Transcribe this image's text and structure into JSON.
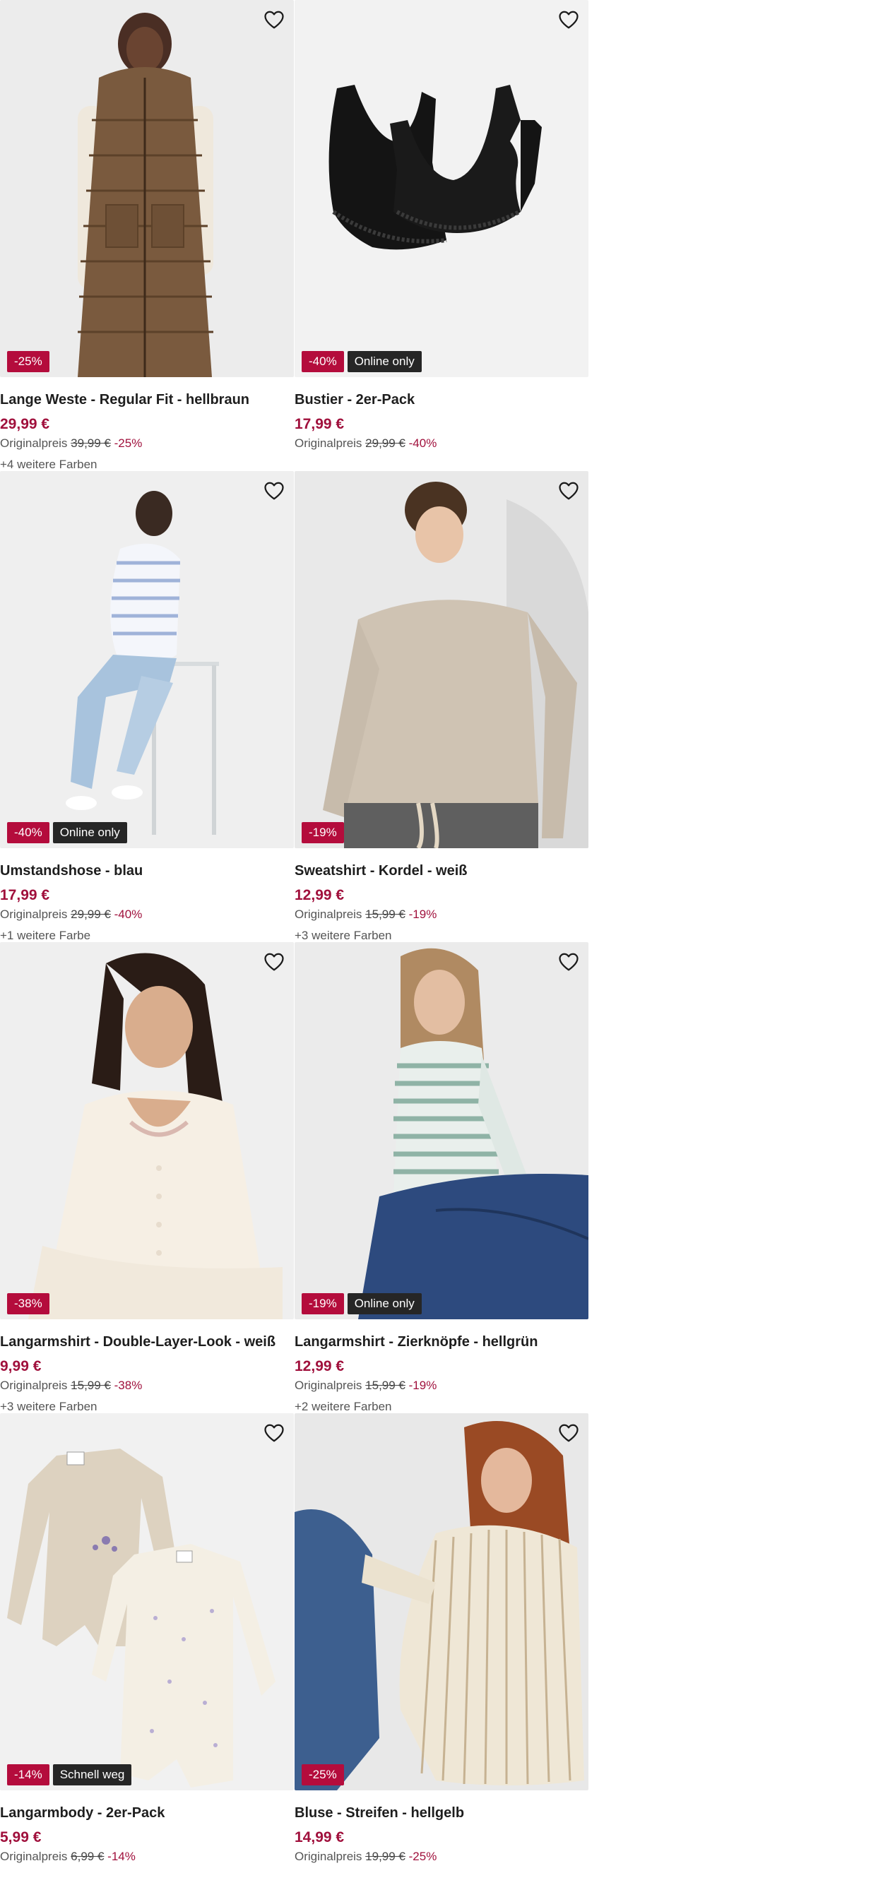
{
  "colors": {
    "discount_badge": "#b40c3c",
    "extra_badge": "#262626",
    "price": "#a0103c"
  },
  "products": [
    {
      "title": "Lange Weste - Regular Fit - hellbraun",
      "price": "29,99 €",
      "orig_label": "Originalpreis",
      "orig_price": "39,99 €",
      "pct": "-25%",
      "discount_badge": "-25%",
      "extra_badge": "",
      "colors_text": "+4 weitere Farben",
      "image": "puffer-vest"
    },
    {
      "title": "Bustier - 2er-Pack",
      "price": "17,99 €",
      "orig_label": "Originalpreis",
      "orig_price": "29,99 €",
      "pct": "-40%",
      "discount_badge": "-40%",
      "extra_badge": "Online only",
      "colors_text": "",
      "image": "black-bustiers"
    },
    {
      "title": "Umstandshose - blau",
      "price": "17,99 €",
      "orig_label": "Originalpreis",
      "orig_price": "29,99 €",
      "pct": "-40%",
      "discount_badge": "-40%",
      "extra_badge": "Online only",
      "colors_text": "+1 weitere Farbe",
      "image": "maternity-jeans"
    },
    {
      "title": "Sweatshirt - Kordel - weiß",
      "price": "12,99 €",
      "orig_label": "Originalpreis",
      "orig_price": "15,99 €",
      "pct": "-19%",
      "discount_badge": "-19%",
      "extra_badge": "",
      "colors_text": "+3 weitere Farben",
      "image": "beige-sweatshirt"
    },
    {
      "title": "Langarmshirt - Double-Layer-Look - weiß",
      "price": "9,99 €",
      "orig_label": "Originalpreis",
      "orig_price": "15,99 €",
      "pct": "-38%",
      "discount_badge": "-38%",
      "extra_badge": "",
      "colors_text": "+3 weitere Farben",
      "image": "cream-longsleeve"
    },
    {
      "title": "Langarmshirt - Zierknöpfe - hellgrün",
      "price": "12,99 €",
      "orig_label": "Originalpreis",
      "orig_price": "15,99 €",
      "pct": "-19%",
      "discount_badge": "-19%",
      "extra_badge": "Online only",
      "colors_text": "+2 weitere Farben",
      "image": "green-striped-shirt"
    },
    {
      "title": "Langarmbody - 2er-Pack",
      "price": "5,99 €",
      "orig_label": "Originalpreis",
      "orig_price": "6,99 €",
      "pct": "-14%",
      "discount_badge": "-14%",
      "extra_badge": "Schnell weg",
      "colors_text": "",
      "image": "baby-bodysuits"
    },
    {
      "title": "Bluse - Streifen - hellgelb",
      "price": "14,99 €",
      "orig_label": "Originalpreis",
      "orig_price": "19,99 €",
      "pct": "-25%",
      "discount_badge": "-25%",
      "extra_badge": "",
      "colors_text": "",
      "image": "striped-blouse"
    }
  ]
}
